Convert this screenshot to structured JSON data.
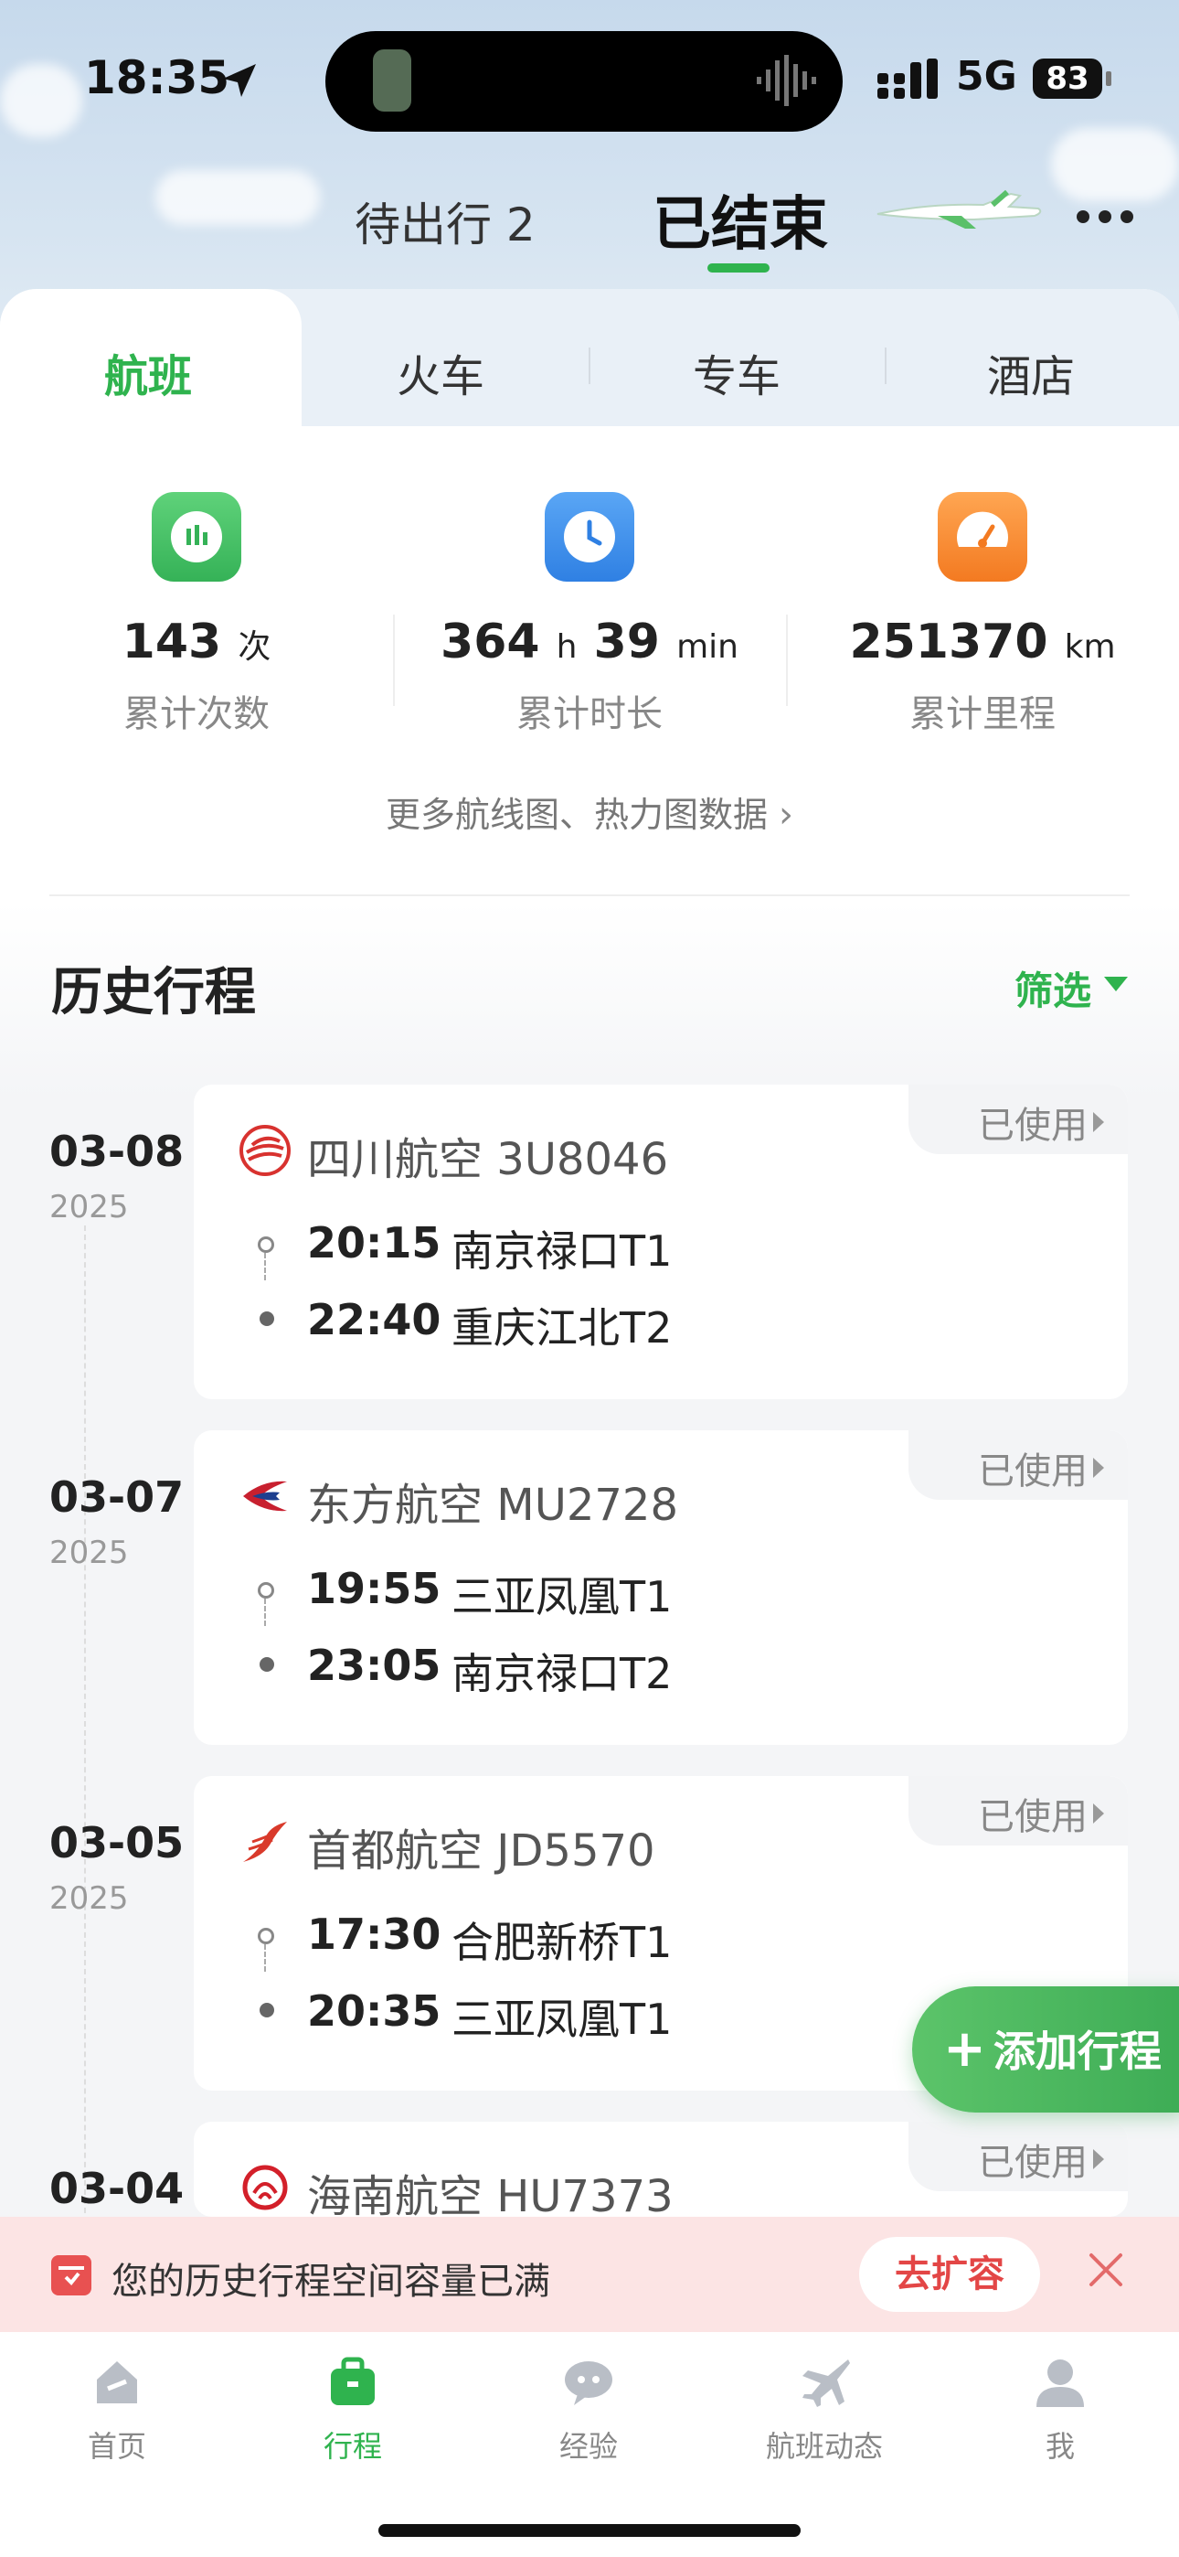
{
  "status_bar": {
    "time": "18:35",
    "network": "5G",
    "battery": "83"
  },
  "top_tabs": {
    "pending": "待出行 2",
    "ended": "已结束"
  },
  "category_tabs": [
    "航班",
    "火车",
    "专车",
    "酒店"
  ],
  "stats": [
    {
      "value": "143",
      "unit": "次",
      "label": "累计次数",
      "color": "#3dbb5e"
    },
    {
      "value": "364",
      "unit": "h",
      "value2": "39",
      "unit2": "min",
      "label": "累计时长",
      "color": "#3f8fe8"
    },
    {
      "value": "251370",
      "unit": "km",
      "label": "累计里程",
      "color": "#f5862e"
    }
  ],
  "more_link": "更多航线图、热力图数据",
  "history": {
    "title": "历史行程",
    "filter_label": "筛选",
    "trips": [
      {
        "date": "03-08",
        "year": "2025",
        "airline": "四川航空",
        "flight": "3U8046",
        "status": "已使用",
        "dep_time": "20:15",
        "dep_port": "南京禄口T1",
        "arr_time": "22:40",
        "arr_port": "重庆江北T2",
        "logo_color": "#d8322f"
      },
      {
        "date": "03-07",
        "year": "2025",
        "airline": "东方航空",
        "flight": "MU2728",
        "status": "已使用",
        "dep_time": "19:55",
        "dep_port": "三亚凤凰T1",
        "arr_time": "23:05",
        "arr_port": "南京禄口T2",
        "logo_color": "#c8202f"
      },
      {
        "date": "03-05",
        "year": "2025",
        "airline": "首都航空",
        "flight": "JD5570",
        "status": "已使用",
        "dep_time": "17:30",
        "dep_port": "合肥新桥T1",
        "arr_time": "20:35",
        "arr_port": "三亚凤凰T1",
        "logo_color": "#d93a2b"
      },
      {
        "date": "03-04",
        "airline": "海南航空",
        "flight": "HU7373",
        "status": "已使用",
        "logo_color": "#d3202a"
      }
    ]
  },
  "add_trip_button": "添加行程",
  "banner": {
    "text": "您的历史行程空间容量已满",
    "action": "去扩容"
  },
  "tabbar": [
    {
      "label": "首页",
      "active": false
    },
    {
      "label": "行程",
      "active": true
    },
    {
      "label": "经验",
      "active": false
    },
    {
      "label": "航班动态",
      "active": false
    },
    {
      "label": "我",
      "active": false
    }
  ]
}
